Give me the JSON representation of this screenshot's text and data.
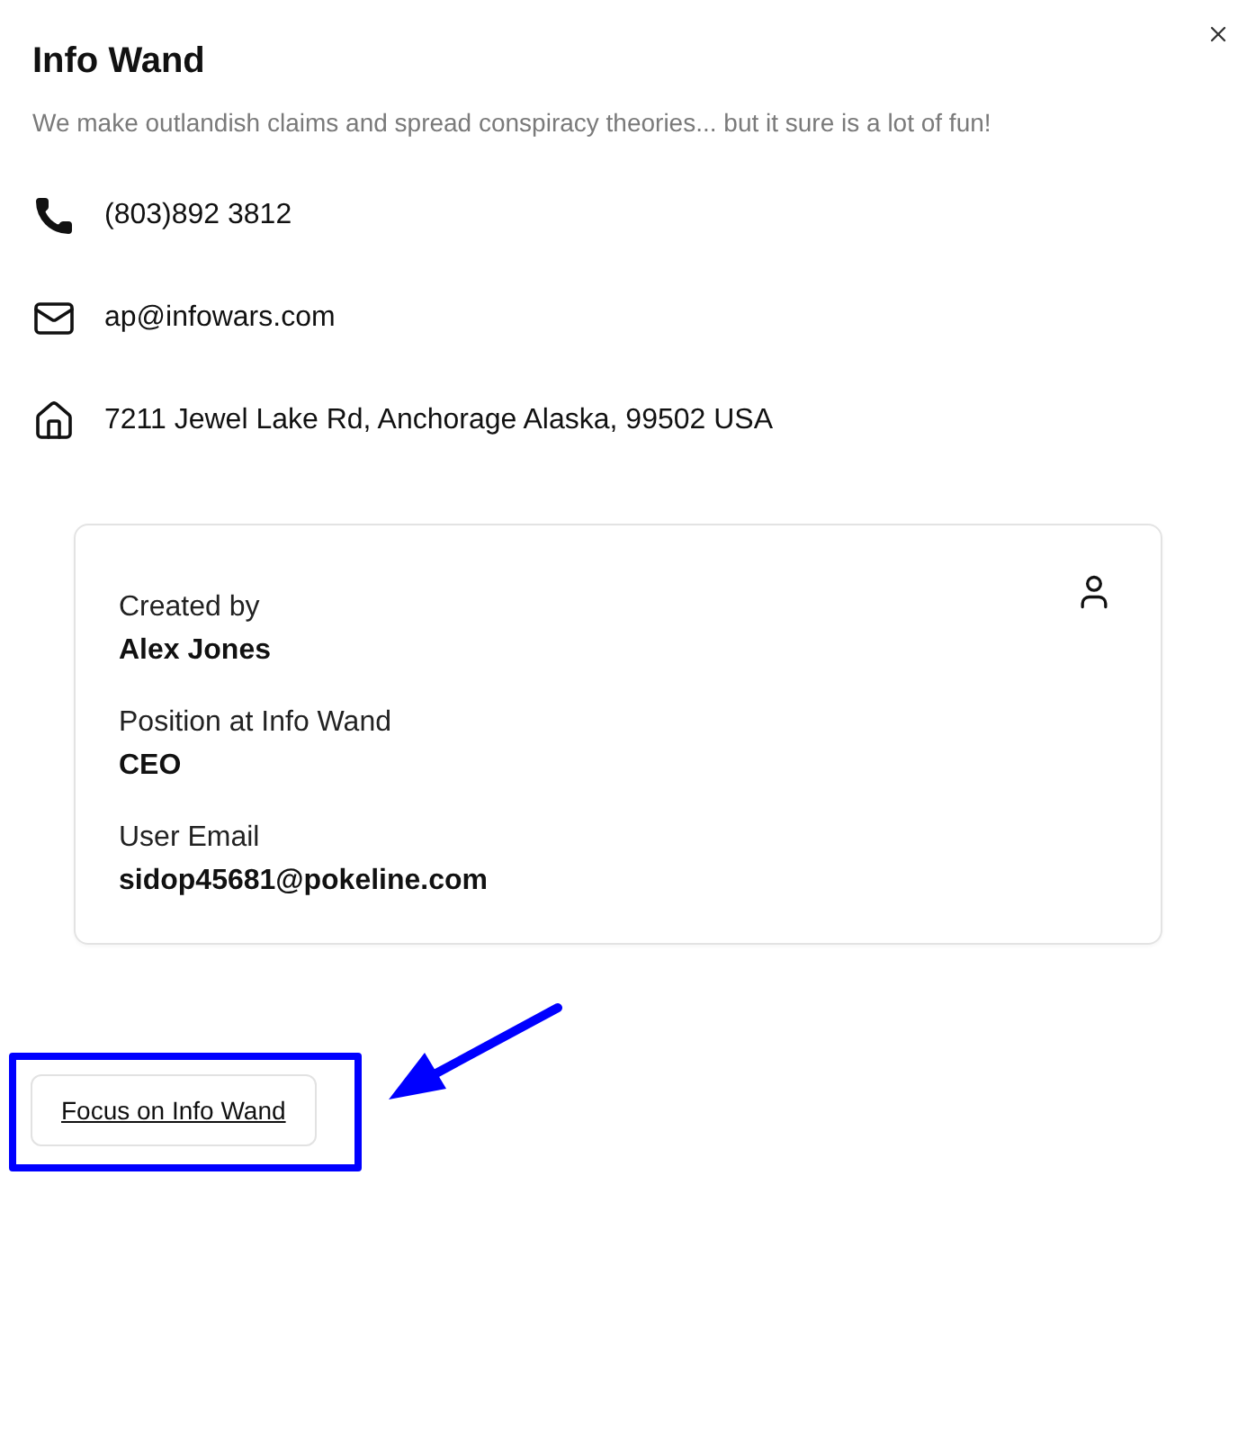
{
  "title": "Info Wand",
  "description": "We make outlandish claims and spread conspiracy theories... but it sure is a lot of fun!",
  "contacts": [
    {
      "kind": "phone",
      "text": "(803)892 3812"
    },
    {
      "kind": "email",
      "text": "ap@infowars.com"
    },
    {
      "kind": "address",
      "text": "7211 Jewel Lake Rd, Anchorage Alaska, 99502 USA"
    }
  ],
  "card": {
    "fields": [
      {
        "label": "Created by",
        "value": "Alex Jones"
      },
      {
        "label": "Position at Info Wand",
        "value": "CEO"
      },
      {
        "label": "User Email",
        "value": "sidop45681@pokeline.com"
      }
    ]
  },
  "focus_button": "Focus on Info Wand"
}
